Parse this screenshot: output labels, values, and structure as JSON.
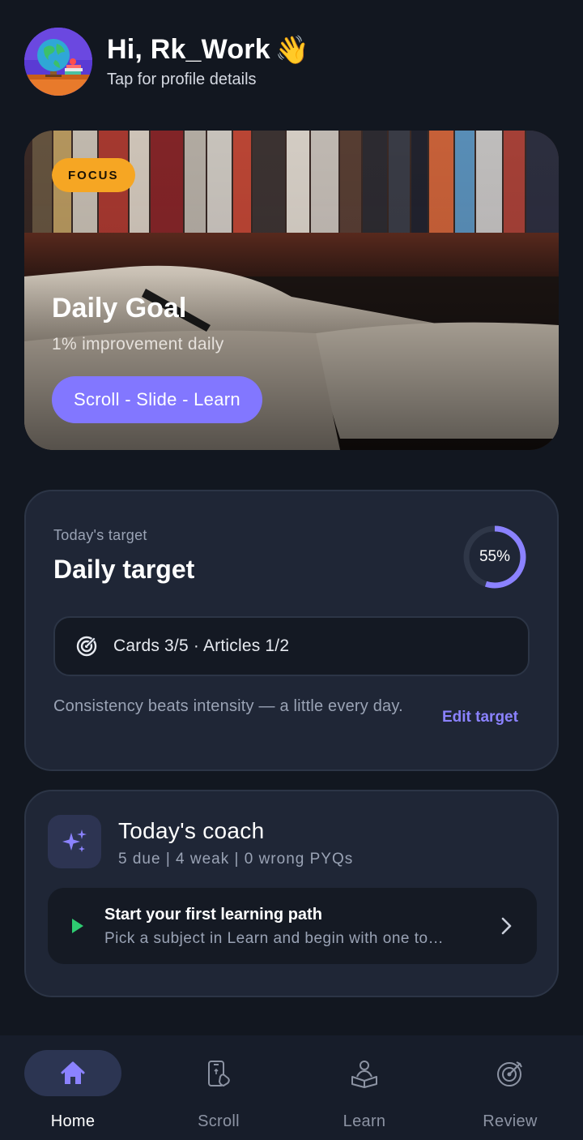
{
  "header": {
    "greeting": "Hi, Rk_Work",
    "wave_emoji": "👋",
    "subtitle": "Tap for profile details",
    "avatar_icon": "globe-desk-avatar"
  },
  "hero": {
    "badge": "FOCUS",
    "title": "Daily Goal",
    "subtitle": "1% improvement daily",
    "button_label": "Scroll - Slide - Learn",
    "colors": {
      "badge": "#f6a623",
      "button": "#8277ff"
    }
  },
  "target": {
    "label": "Today's target",
    "title": "Daily target",
    "progress_text": "55%",
    "progress_value": 0.55,
    "stats_icon": "target-icon",
    "stats": "Cards 3/5 · Articles 1/2",
    "quote": "Consistency beats intensity — a little every day.",
    "edit_label": "Edit target"
  },
  "coach": {
    "icon": "sparkles-icon",
    "title": "Today's coach",
    "stats": "5 due | 4 weak | 0 wrong PYQs",
    "path_title": "Start your first learning path",
    "path_subtitle": "Pick a subject in Learn and begin with one to…",
    "play_color": "#2ecc71"
  },
  "nav": {
    "items": [
      {
        "label": "Home",
        "icon": "home-icon",
        "active": true
      },
      {
        "label": "Scroll",
        "icon": "phone-swipe-icon",
        "active": false
      },
      {
        "label": "Learn",
        "icon": "reader-icon",
        "active": false
      },
      {
        "label": "Review",
        "icon": "target-arrow-icon",
        "active": false
      }
    ],
    "accent": "#8b82ff"
  }
}
